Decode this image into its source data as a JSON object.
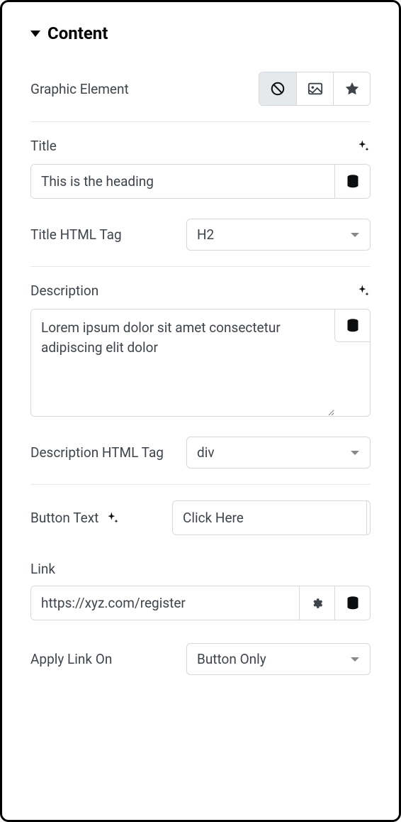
{
  "section": {
    "title": "Content"
  },
  "graphic_element": {
    "label": "Graphic Element"
  },
  "title": {
    "label": "Title",
    "value": "This is the heading"
  },
  "title_tag": {
    "label": "Title HTML Tag",
    "value": "H2"
  },
  "description": {
    "label": "Description",
    "value": "Lorem ipsum dolor sit amet consectetur adipiscing elit dolor"
  },
  "description_tag": {
    "label": "Description HTML Tag",
    "value": "div"
  },
  "button_text": {
    "label": "Button Text",
    "value": "Click Here"
  },
  "link": {
    "label": "Link",
    "value": "https://xyz.com/register"
  },
  "apply_link": {
    "label": "Apply Link On",
    "value": "Button Only"
  }
}
